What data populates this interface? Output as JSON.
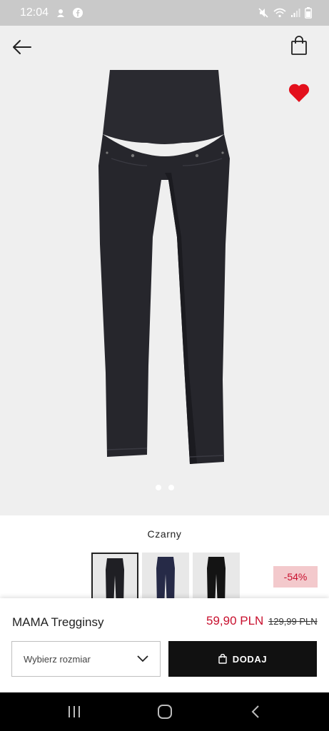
{
  "status_bar": {
    "time": "12:04",
    "icons": [
      "notification-icon",
      "facebook-icon",
      "mute-icon",
      "wifi-icon",
      "signal-icon",
      "battery-icon"
    ]
  },
  "header": {
    "back_icon": "arrow-left-icon",
    "bag_icon": "shopping-bag-icon",
    "favorite_icon": "heart-icon",
    "favorite_color": "#e3101c"
  },
  "gallery": {
    "image": "product-photo",
    "image_count": 2,
    "active_index": 0
  },
  "product": {
    "color_name": "Czarny",
    "swatches": [
      {
        "name": "black",
        "color": "#1f1f24",
        "selected": true
      },
      {
        "name": "navy",
        "color": "#262a47",
        "selected": false
      },
      {
        "name": "black-plain",
        "color": "#141414",
        "selected": false
      }
    ],
    "discount": "-54%",
    "name": "MAMA Tregginsy",
    "price_now": "59,90 PLN",
    "price_old": "129,99 PLN"
  },
  "actions": {
    "size_placeholder": "Wybierz rozmiar",
    "add_label": "DODAJ"
  },
  "colors": {
    "sale_red": "#c8102e",
    "discount_bg": "#f3c9cc",
    "button_bg": "#111111"
  }
}
